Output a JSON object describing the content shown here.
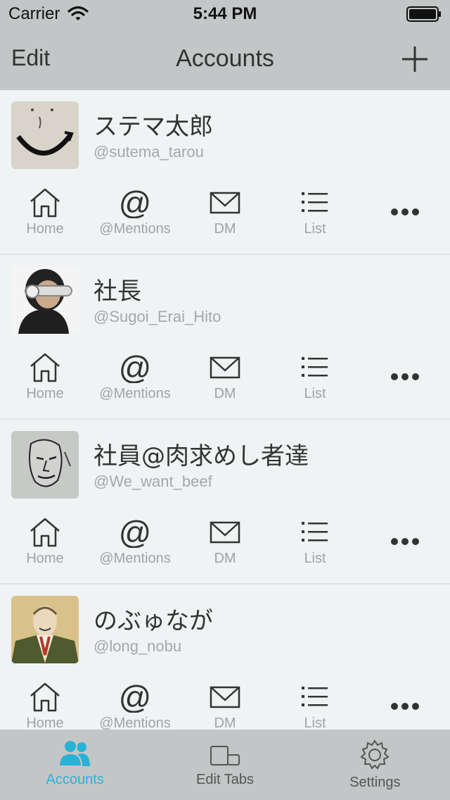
{
  "status_bar": {
    "carrier": "Carrier",
    "time": "5:44 PM"
  },
  "nav": {
    "edit_label": "Edit",
    "title": "Accounts",
    "add_icon": "plus-icon"
  },
  "action_labels": {
    "home": "Home",
    "mentions": "@Mentions",
    "dm": "DM",
    "list": "List"
  },
  "accounts": [
    {
      "name": "ステマ太郎",
      "handle": "@sutema_tarou"
    },
    {
      "name": "社長",
      "handle": "@Sugoi_Erai_Hito"
    },
    {
      "name": "社員@肉求めし者達",
      "handle": "@We_want_beef"
    },
    {
      "name": "のぶゅなが",
      "handle": "@long_nobu"
    }
  ],
  "tabs": [
    {
      "label": "Accounts",
      "icon": "people-icon",
      "active": true
    },
    {
      "label": "Edit Tabs",
      "icon": "devices-icon",
      "active": false
    },
    {
      "label": "Settings",
      "icon": "gear-icon",
      "active": false
    }
  ],
  "colors": {
    "accent": "#2bb1d6",
    "bar": "#c3c6c6",
    "background": "#eff3f3"
  }
}
